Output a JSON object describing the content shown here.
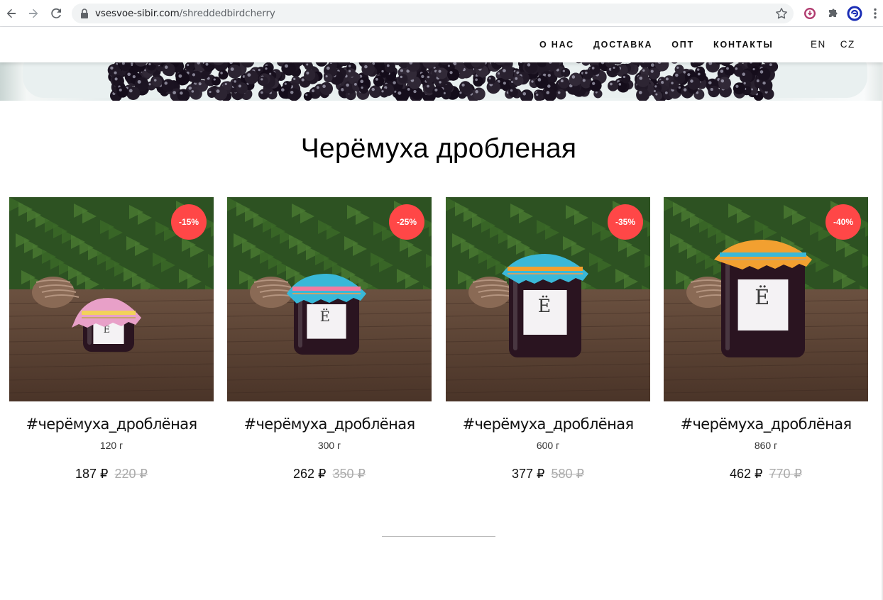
{
  "browser": {
    "url_host": "vsesvoe-sibir.com",
    "url_path": "/shreddedbirdcherry",
    "icons": [
      "back-arrow-icon",
      "forward-arrow-icon",
      "reload-icon",
      "lock-icon",
      "star-icon",
      "download-extension-icon",
      "puzzle-icon",
      "profile-extension-icon",
      "kebab-menu-icon"
    ]
  },
  "header": {
    "menu": [
      {
        "label": "О НАС"
      },
      {
        "label": "ДОСТАВКА"
      },
      {
        "label": "ОПТ"
      },
      {
        "label": "КОНТАКТЫ"
      }
    ],
    "languages": [
      {
        "label": "EN"
      },
      {
        "label": "CZ"
      }
    ]
  },
  "page": {
    "title": "Черёмуха дробленая"
  },
  "products": [
    {
      "name": "#черёмуха_дроблёная",
      "weight": "120 г",
      "discount": "-15%",
      "price": "187 ₽",
      "old_price": "220 ₽"
    },
    {
      "name": "#черёмуха_дроблёная",
      "weight": "300 г",
      "discount": "-25%",
      "price": "262 ₽",
      "old_price": "350 ₽"
    },
    {
      "name": "#черёмуха_дроблёная",
      "weight": "600 г",
      "discount": "-35%",
      "price": "377 ₽",
      "old_price": "580 ₽"
    },
    {
      "name": "#черёмуха_дроблёная",
      "weight": "860 г",
      "discount": "-40%",
      "price": "462 ₽",
      "old_price": "770 ₽"
    }
  ],
  "colors": {
    "badge": "#ff4747",
    "old_price": "#aaaaaa",
    "jam": "#2a1420",
    "wood": "#5b4133",
    "pine": "#2e5a23"
  }
}
